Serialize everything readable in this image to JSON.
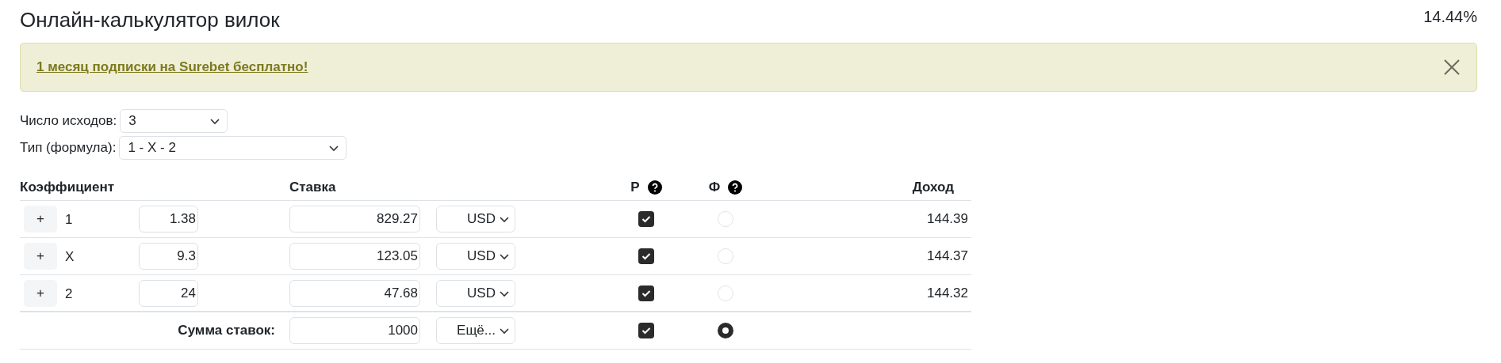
{
  "title": "Онлайн-калькулятор вилок",
  "profit": "14.44%",
  "alert": {
    "link": "1 месяц подписки на Surebet бесплатно!"
  },
  "settings": [
    {
      "label": "Число исходов:",
      "value": "3",
      "kind": "short"
    },
    {
      "label": "Тип (формула):",
      "value": "1 - X - 2",
      "kind": "wide"
    }
  ],
  "table": {
    "columns": [
      "Коэффициент",
      "Ставка",
      "Р",
      "Ф",
      "Доход"
    ],
    "rows": [
      {
        "button": "+",
        "outcome": "1",
        "odds": "1.38",
        "stake": "829.27",
        "currency": "USD",
        "rounding": true,
        "fixed": false,
        "income": "144.39"
      },
      {
        "button": "+",
        "outcome": "X",
        "odds": "9.3",
        "stake": "123.05",
        "currency": "USD",
        "rounding": true,
        "fixed": false,
        "income": "144.37"
      },
      {
        "button": "+",
        "outcome": "2",
        "odds": "24",
        "stake": "47.68",
        "currency": "USD",
        "rounding": true,
        "fixed": false,
        "income": "144.32"
      }
    ],
    "total": {
      "label": "Сумма ставок:",
      "stake": "1000",
      "currency": "Ещё...",
      "rounding": true,
      "fixed": true
    }
  }
}
